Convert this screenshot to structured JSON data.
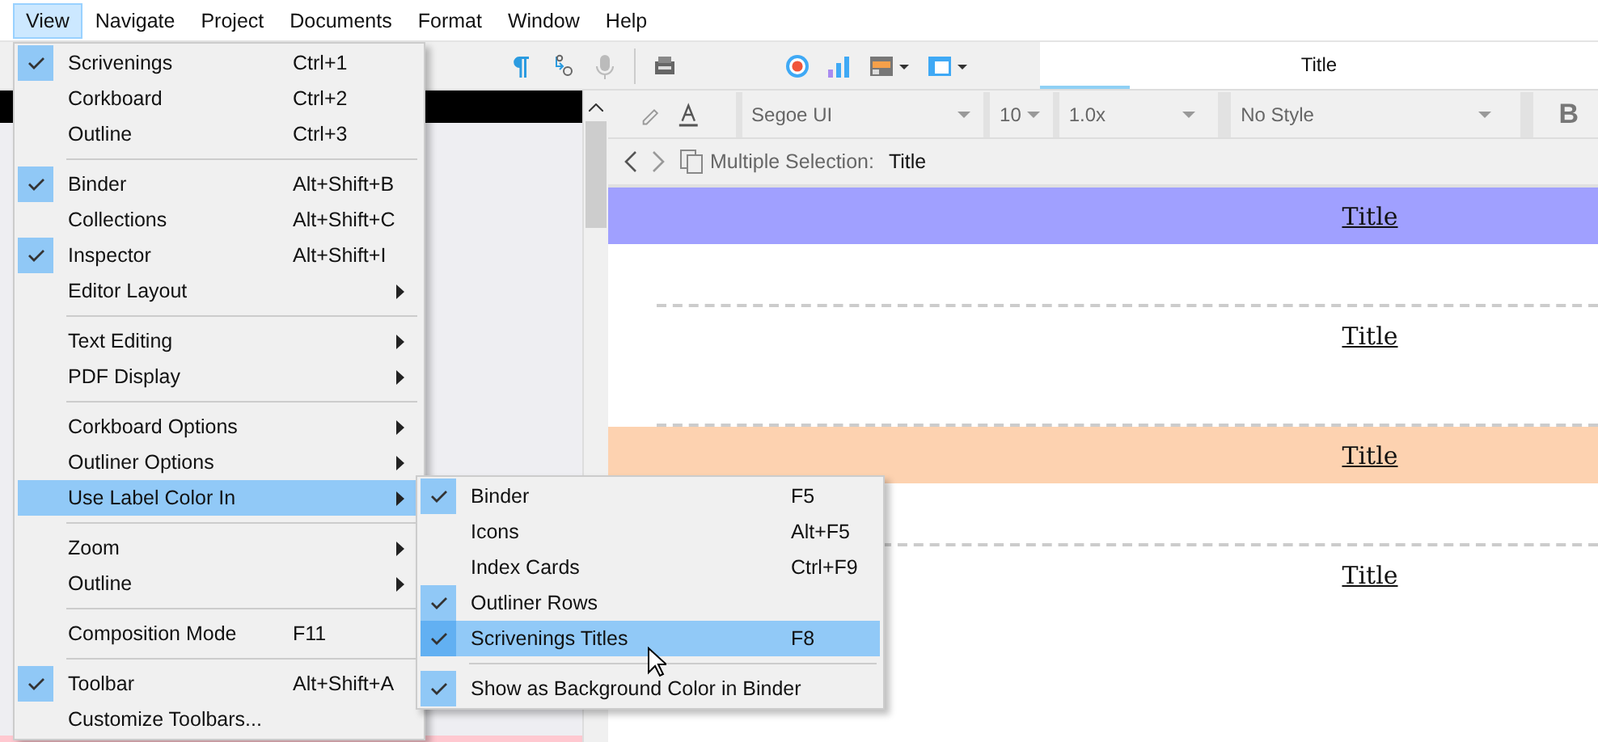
{
  "menubar": [
    {
      "label": "View",
      "selected": true
    },
    {
      "label": "Navigate",
      "selected": false
    },
    {
      "label": "Project",
      "selected": false
    },
    {
      "label": "Documents",
      "selected": false
    },
    {
      "label": "Format",
      "selected": false
    },
    {
      "label": "Window",
      "selected": false
    },
    {
      "label": "Help",
      "selected": false
    }
  ],
  "toolbar": {
    "header_tab": "Title"
  },
  "format_bar": {
    "font": "Segoe UI",
    "size": "10",
    "spacing": "1.0x",
    "style": "No Style",
    "bold_button": "B"
  },
  "navigation": {
    "label": "Multiple Selection:",
    "title": "Title"
  },
  "documents": [
    {
      "title": "Title",
      "color": "#a0a0ff"
    },
    {
      "title": "Title"
    },
    {
      "title": "Title",
      "color": "#fdd2b0"
    },
    {
      "title": "Title"
    }
  ],
  "view_menu": [
    [
      {
        "label": "Scrivenings",
        "shortcut": "Ctrl+1",
        "checked": true,
        "submenu": false,
        "selected": false
      },
      {
        "label": "Corkboard",
        "shortcut": "Ctrl+2",
        "checked": false,
        "submenu": false,
        "selected": false
      },
      {
        "label": "Outline",
        "shortcut": "Ctrl+3",
        "checked": false,
        "submenu": false,
        "selected": false
      }
    ],
    [
      {
        "label": "Binder",
        "shortcut": "Alt+Shift+B",
        "checked": true,
        "submenu": false,
        "selected": false
      },
      {
        "label": "Collections",
        "shortcut": "Alt+Shift+C",
        "checked": false,
        "submenu": false,
        "selected": false
      },
      {
        "label": "Inspector",
        "shortcut": "Alt+Shift+I",
        "checked": true,
        "submenu": false,
        "selected": false
      },
      {
        "label": "Editor Layout",
        "checked": false,
        "submenu": true,
        "selected": false
      }
    ],
    [
      {
        "label": "Text Editing",
        "checked": false,
        "submenu": true,
        "selected": false
      },
      {
        "label": "PDF Display",
        "checked": false,
        "submenu": true,
        "selected": false
      }
    ],
    [
      {
        "label": "Corkboard Options",
        "checked": false,
        "submenu": true,
        "selected": false
      },
      {
        "label": "Outliner Options",
        "checked": false,
        "submenu": true,
        "selected": false
      },
      {
        "label": "Use Label Color In",
        "checked": false,
        "submenu": true,
        "selected": true
      }
    ],
    [
      {
        "label": "Zoom",
        "checked": false,
        "submenu": true,
        "selected": false
      },
      {
        "label": "Outline",
        "checked": false,
        "submenu": true,
        "selected": false
      }
    ],
    [
      {
        "label": "Composition Mode",
        "shortcut": "F11",
        "checked": false,
        "submenu": false,
        "selected": false
      }
    ],
    [
      {
        "label": "Toolbar",
        "shortcut": "Alt+Shift+A",
        "checked": true,
        "submenu": false,
        "selected": false
      },
      {
        "label": "Customize Toolbars...",
        "checked": false,
        "submenu": false,
        "selected": false
      }
    ]
  ],
  "label_color_submenu": [
    [
      {
        "label": "Binder",
        "shortcut": "F5",
        "checked": true,
        "submenu": false,
        "selected": false
      },
      {
        "label": "Icons",
        "shortcut": "Alt+F5",
        "checked": false,
        "submenu": false,
        "selected": false
      },
      {
        "label": "Index Cards",
        "shortcut": "Ctrl+F9",
        "checked": false,
        "submenu": false,
        "selected": false
      },
      {
        "label": "Outliner Rows",
        "checked": true,
        "submenu": false,
        "selected": false
      },
      {
        "label": "Scrivenings Titles",
        "shortcut": "F8",
        "checked": true,
        "submenu": false,
        "selected": true
      }
    ],
    [
      {
        "label": "Show as Background Color in Binder",
        "checked": true,
        "submenu": false,
        "selected": false
      }
    ]
  ]
}
